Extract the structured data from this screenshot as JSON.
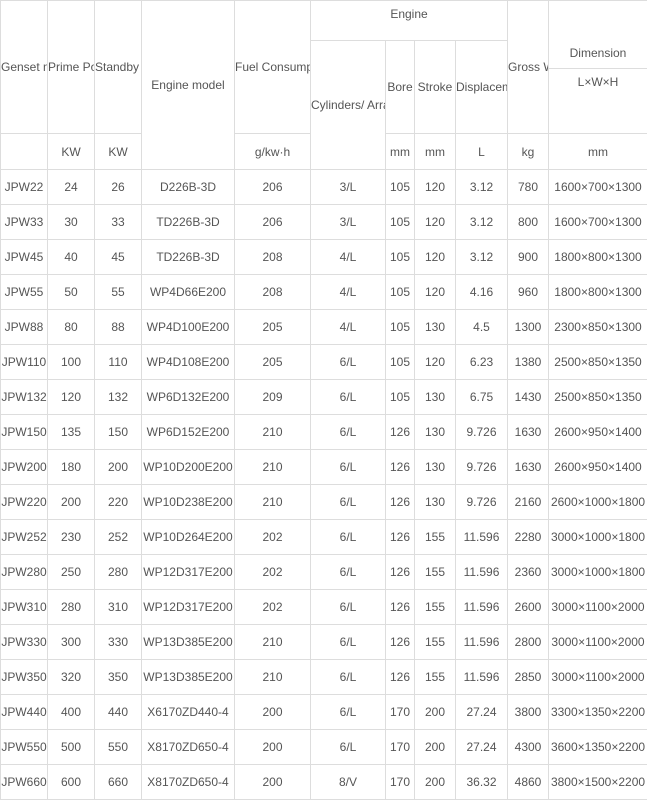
{
  "headers": {
    "genset_model": "Genset model",
    "prime_power": "Prime Power",
    "standby_power": "Standby Power",
    "engine_model": "Engine model",
    "fuel_consumption": "Fuel Consumption",
    "engine": "Engine",
    "cylinders": "Cylinders/ Arrangement",
    "bore": "Bore",
    "stroke": "Stroke",
    "displacement": "Displacement",
    "gross_weight": "Gross Weight",
    "dimension": "Dimension",
    "dimension_sub": "L×W×H"
  },
  "units": {
    "prime": "KW",
    "standby": "KW",
    "fuel": "g/kw·h",
    "bore": "mm",
    "stroke": "mm",
    "disp": "L",
    "weight": "kg",
    "dimension": "mm"
  },
  "rows": [
    {
      "model": "JPW22",
      "prime": "24",
      "standby": "26",
      "engine": "D226B-3D",
      "fuel": "206",
      "cyl": "3/L",
      "bore": "105",
      "stroke": "120",
      "disp": "3.12",
      "weight": "780",
      "dim": "1600×700×1300"
    },
    {
      "model": "JPW33",
      "prime": "30",
      "standby": "33",
      "engine": "TD226B-3D",
      "fuel": "206",
      "cyl": "3/L",
      "bore": "105",
      "stroke": "120",
      "disp": "3.12",
      "weight": "800",
      "dim": "1600×700×1300"
    },
    {
      "model": "JPW45",
      "prime": "40",
      "standby": "45",
      "engine": "TD226B-3D",
      "fuel": "208",
      "cyl": "4/L",
      "bore": "105",
      "stroke": "120",
      "disp": "3.12",
      "weight": "900",
      "dim": "1800×800×1300"
    },
    {
      "model": "JPW55",
      "prime": "50",
      "standby": "55",
      "engine": "WP4D66E200",
      "fuel": "208",
      "cyl": "4/L",
      "bore": "105",
      "stroke": "120",
      "disp": "4.16",
      "weight": "960",
      "dim": "1800×800×1300"
    },
    {
      "model": "JPW88",
      "prime": "80",
      "standby": "88",
      "engine": "WP4D100E200",
      "fuel": "205",
      "cyl": "4/L",
      "bore": "105",
      "stroke": "130",
      "disp": "4.5",
      "weight": "1300",
      "dim": "2300×850×1300"
    },
    {
      "model": "JPW110",
      "prime": "100",
      "standby": "110",
      "engine": "WP4D108E200",
      "fuel": "205",
      "cyl": "6/L",
      "bore": "105",
      "stroke": "120",
      "disp": "6.23",
      "weight": "1380",
      "dim": "2500×850×1350"
    },
    {
      "model": "JPW132",
      "prime": "120",
      "standby": "132",
      "engine": "WP6D132E200",
      "fuel": "209",
      "cyl": "6/L",
      "bore": "105",
      "stroke": "130",
      "disp": "6.75",
      "weight": "1430",
      "dim": "2500×850×1350"
    },
    {
      "model": "JPW150",
      "prime": "135",
      "standby": "150",
      "engine": "WP6D152E200",
      "fuel": "210",
      "cyl": "6/L",
      "bore": "126",
      "stroke": "130",
      "disp": "9.726",
      "weight": "1630",
      "dim": "2600×950×1400"
    },
    {
      "model": "JPW200",
      "prime": "180",
      "standby": "200",
      "engine": "WP10D200E200",
      "fuel": "210",
      "cyl": "6/L",
      "bore": "126",
      "stroke": "130",
      "disp": "9.726",
      "weight": "1630",
      "dim": "2600×950×1400"
    },
    {
      "model": "JPW220",
      "prime": "200",
      "standby": "220",
      "engine": "WP10D238E200",
      "fuel": "210",
      "cyl": "6/L",
      "bore": "126",
      "stroke": "130",
      "disp": "9.726",
      "weight": "2160",
      "dim": "2600×1000×1800"
    },
    {
      "model": "JPW252",
      "prime": "230",
      "standby": "252",
      "engine": "WP10D264E200",
      "fuel": "202",
      "cyl": "6/L",
      "bore": "126",
      "stroke": "155",
      "disp": "11.596",
      "weight": "2280",
      "dim": "3000×1000×1800"
    },
    {
      "model": "JPW280",
      "prime": "250",
      "standby": "280",
      "engine": "WP12D317E200",
      "fuel": "202",
      "cyl": "6/L",
      "bore": "126",
      "stroke": "155",
      "disp": "11.596",
      "weight": "2360",
      "dim": "3000×1000×1800"
    },
    {
      "model": "JPW310",
      "prime": "280",
      "standby": "310",
      "engine": "WP12D317E200",
      "fuel": "202",
      "cyl": "6/L",
      "bore": "126",
      "stroke": "155",
      "disp": "11.596",
      "weight": "2600",
      "dim": "3000×1100×2000"
    },
    {
      "model": "JPW330",
      "prime": "300",
      "standby": "330",
      "engine": "WP13D385E200",
      "fuel": "210",
      "cyl": "6/L",
      "bore": "126",
      "stroke": "155",
      "disp": "11.596",
      "weight": "2800",
      "dim": "3000×1100×2000"
    },
    {
      "model": "JPW350",
      "prime": "320",
      "standby": "350",
      "engine": "WP13D385E200",
      "fuel": "210",
      "cyl": "6/L",
      "bore": "126",
      "stroke": "155",
      "disp": "11.596",
      "weight": "2850",
      "dim": "3000×1100×2000"
    },
    {
      "model": "JPW440",
      "prime": "400",
      "standby": "440",
      "engine": "X6170ZD440-4",
      "fuel": "200",
      "cyl": "6/L",
      "bore": "170",
      "stroke": "200",
      "disp": "27.24",
      "weight": "3800",
      "dim": "3300×1350×2200"
    },
    {
      "model": "JPW550",
      "prime": "500",
      "standby": "550",
      "engine": "X8170ZD650-4",
      "fuel": "200",
      "cyl": "6/L",
      "bore": "170",
      "stroke": "200",
      "disp": "27.24",
      "weight": "4300",
      "dim": "3600×1350×2200"
    },
    {
      "model": "JPW660",
      "prime": "600",
      "standby": "660",
      "engine": "X8170ZD650-4",
      "fuel": "200",
      "cyl": "8/V",
      "bore": "170",
      "stroke": "200",
      "disp": "36.32",
      "weight": "4860",
      "dim": "3800×1500×2200"
    }
  ]
}
